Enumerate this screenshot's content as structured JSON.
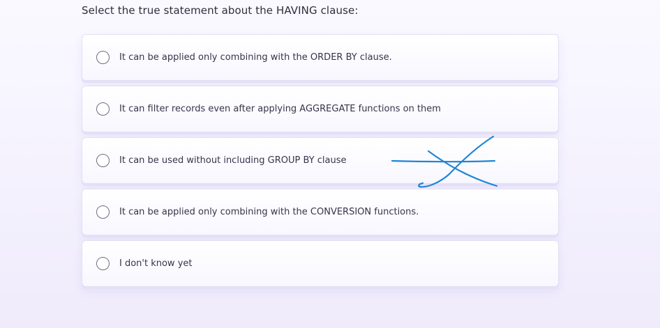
{
  "question": {
    "text": "Select the true statement about the HAVING clause:"
  },
  "options": [
    {
      "label": "It can be applied only combining with the ORDER BY clause."
    },
    {
      "label": "It can filter records even after applying AGGREGATE functions on them"
    },
    {
      "label": "It can be used without including GROUP BY clause"
    },
    {
      "label": "It can be applied only combining with the CONVERSION functions."
    },
    {
      "label": "I don't know yet"
    }
  ],
  "annotation": {
    "color": "#1f86d6"
  }
}
